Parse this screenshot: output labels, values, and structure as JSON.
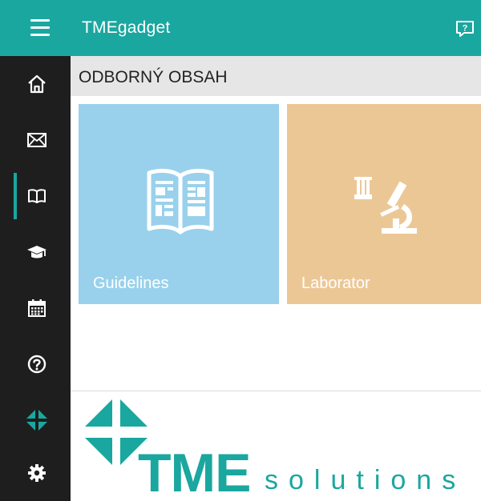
{
  "app": {
    "title": "TMEgadget"
  },
  "header": {
    "menu_icon": "hamburger-menu-icon",
    "feedback_icon": "feedback-icon"
  },
  "sidebar": {
    "items": [
      {
        "id": "home",
        "icon": "home-icon"
      },
      {
        "id": "messages",
        "icon": "mail-icon"
      },
      {
        "id": "content",
        "icon": "book-icon",
        "active": true
      },
      {
        "id": "education",
        "icon": "graduation-cap-icon"
      },
      {
        "id": "calendar",
        "icon": "calendar-icon"
      },
      {
        "id": "help",
        "icon": "help-icon"
      },
      {
        "id": "tme",
        "icon": "tme-logo-icon"
      },
      {
        "id": "settings",
        "icon": "gear-icon"
      }
    ],
    "accent": "#1aa79f"
  },
  "section": {
    "title": "ODBORNÝ OBSAH"
  },
  "tiles": [
    {
      "label": "Guidelines",
      "icon": "guidelines-book-icon",
      "color": "#99d1ec"
    },
    {
      "label": "Laborator",
      "icon": "microscope-icon",
      "color": "#ecc796"
    }
  ],
  "footer": {
    "brand": "TME",
    "sub": "solutions",
    "color": "#1aa79f"
  }
}
